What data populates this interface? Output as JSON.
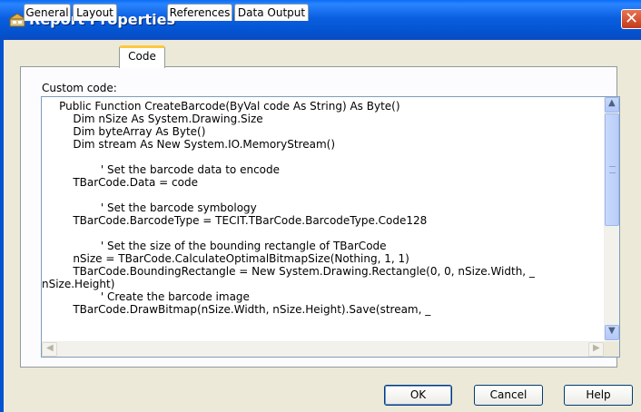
{
  "window": {
    "title": "Report Properties"
  },
  "tabs": [
    {
      "label": "General",
      "active": false
    },
    {
      "label": "Layout",
      "active": false
    },
    {
      "label": "Code",
      "active": true
    },
    {
      "label": "References",
      "active": false
    },
    {
      "label": "Data Output",
      "active": false
    }
  ],
  "code_panel": {
    "label": "Custom code:",
    "lines": [
      "     Public Function CreateBarcode(ByVal code As String) As Byte()",
      "         Dim nSize As System.Drawing.Size",
      "         Dim byteArray As Byte()",
      "         Dim stream As New System.IO.MemoryStream()",
      "",
      "                 ' Set the barcode data to encode",
      "         TBarCode.Data = code",
      "",
      "                 ' Set the barcode symbology",
      "         TBarCode.BarcodeType = TECIT.TBarCode.BarcodeType.Code128",
      "",
      "                 ' Set the size of the bounding rectangle of TBarCode",
      "         nSize = TBarCode.CalculateOptimalBitmapSize(Nothing, 1, 1)",
      "         TBarCode.BoundingRectangle = New System.Drawing.Rectangle(0, 0, nSize.Width, _",
      "nSize.Height)",
      "                 ' Create the barcode image",
      "         TBarCode.DrawBitmap(nSize.Width, nSize.Height).Save(stream, _"
    ]
  },
  "buttons": {
    "ok": "OK",
    "cancel": "Cancel",
    "help": "Help"
  },
  "colors": {
    "titlebar": "#0353d0",
    "dialog_bg": "#ece9d8",
    "active_tab_accent": "#ffc83c",
    "close_button": "#c3391a"
  },
  "icons": {
    "title": "report-properties-icon",
    "close": "close-icon"
  }
}
